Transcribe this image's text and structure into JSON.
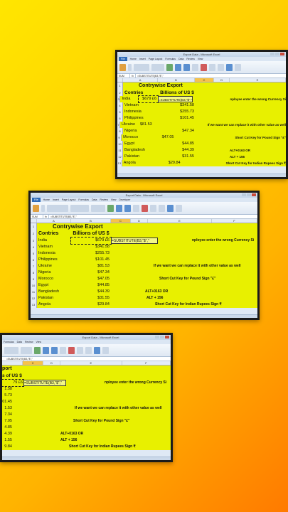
{
  "window_title": "Export Data - Microsoft Excel",
  "ribbon_tabs": [
    "File",
    "Home",
    "Insert",
    "Page Layout",
    "Formulas",
    "Data",
    "Review",
    "View",
    "Developer"
  ],
  "name_box": "SUM",
  "formula_text": "=SUBSTITUTE(B3,\"$\",\"",
  "columns": [
    "A",
    "B",
    "C",
    "D",
    "E",
    "F"
  ],
  "title": "Contrywise Export",
  "headers": {
    "country": "Contries",
    "value": "Billions of US $"
  },
  "rows": [
    {
      "n": "3",
      "country": "India",
      "value": "$679 £6",
      "formula": "=SUBSTITUTE(B3,\"$\",\"",
      "note": "nployee enter the wrong Currency Si"
    },
    {
      "n": "4",
      "country": "Vietnam",
      "value": "$341.58",
      "formula": "",
      "note": ""
    },
    {
      "n": "5",
      "country": "Indonesia",
      "value": "$255.73",
      "formula": "",
      "note": ""
    },
    {
      "n": "6",
      "country": "Philippines",
      "value": "$101.45",
      "formula": "",
      "note": ""
    },
    {
      "n": "7",
      "country": "Ukraine",
      "value": "$81.53",
      "formula": "",
      "note": "If we want we can replace it with other value as well"
    },
    {
      "n": "8",
      "country": "Nigeria",
      "value": "$47.34",
      "formula": "",
      "note": ""
    },
    {
      "n": "9",
      "country": "Morocco",
      "value": "$47.05",
      "formula": "",
      "note": "Short Cut Key for Pound Sign \"£\""
    },
    {
      "n": "10",
      "country": "Egypt",
      "value": "$44.85",
      "formula": "",
      "note": ""
    },
    {
      "n": "11",
      "country": "Bangladesh",
      "value": "$44.39",
      "formula": "",
      "note": "ALT+0163 OR"
    },
    {
      "n": "12",
      "country": "Pakistan",
      "value": "$31.55",
      "formula": "",
      "note": "ALT + 156"
    },
    {
      "n": "13",
      "country": "Angola",
      "value": "$29.84",
      "formula": "",
      "note": "Short Cut Key for Indian Rupees Sign ₹"
    }
  ],
  "crop3_values": [
    "79 £6",
    "1.58",
    "5.73",
    "01.45",
    "1.53",
    "7.34",
    "7.05",
    "4.85",
    "4.39",
    "1.55",
    "9.84"
  ],
  "crop3_title_frag": "port",
  "crop3_header_frag": "s of US $"
}
